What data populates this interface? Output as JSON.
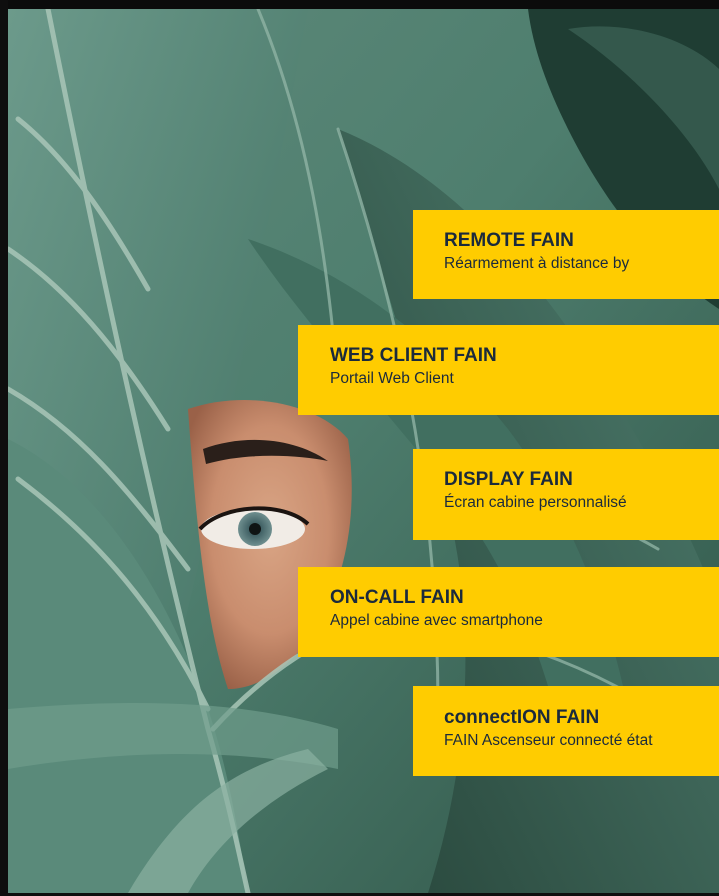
{
  "colors": {
    "card_background": "#ffcc00",
    "card_text": "#1b2a3c",
    "leaf_green": "#4d8773",
    "frame": "#0b0b0b"
  },
  "image": {
    "subject": "woman-eye-behind-leaves-photo"
  },
  "features": [
    {
      "title": "REMOTE FAIN",
      "subtitle": "Réarmement  à distance by"
    },
    {
      "title": "WEB CLIENT FAIN",
      "subtitle": "Portail Web Client"
    },
    {
      "title": "DISPLAY FAIN",
      "subtitle": "Écran cabine personnalisé"
    },
    {
      "title": "ON-CALL FAIN",
      "subtitle": "Appel cabine avec smartphone"
    },
    {
      "title": "connectION FAIN",
      "subtitle": "FAIN Ascenseur connecté état"
    }
  ]
}
